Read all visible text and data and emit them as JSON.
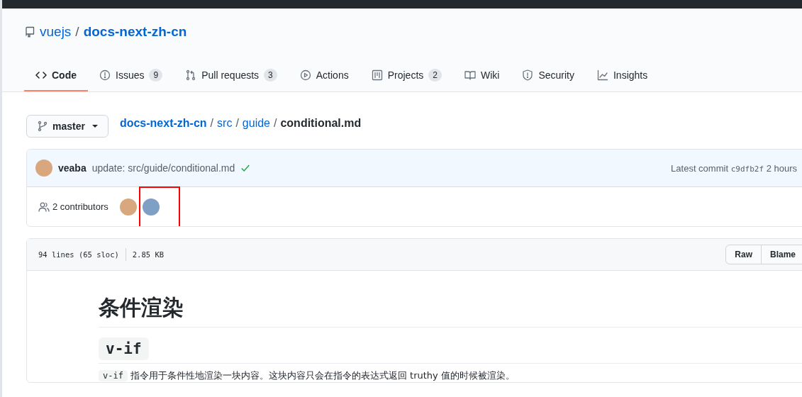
{
  "repo": {
    "owner": "vuejs",
    "separator": "/",
    "name": "docs-next-zh-cn"
  },
  "tabs": [
    {
      "label": "Code",
      "selected": true
    },
    {
      "label": "Issues",
      "count": "9",
      "selected": false
    },
    {
      "label": "Pull requests",
      "count": "3",
      "selected": false
    },
    {
      "label": "Actions",
      "selected": false
    },
    {
      "label": "Projects",
      "count": "2",
      "selected": false
    },
    {
      "label": "Wiki",
      "selected": false
    },
    {
      "label": "Security",
      "selected": false
    },
    {
      "label": "Insights",
      "selected": false
    }
  ],
  "branch": {
    "label": "master"
  },
  "breadcrumb": {
    "links": [
      "docs-next-zh-cn",
      "src",
      "guide"
    ],
    "separator": "/",
    "current": "conditional.md"
  },
  "commit": {
    "author": "veaba",
    "message": "update: src/guide/conditional.md",
    "status_ok": true,
    "latest_label": "Latest commit",
    "sha": "c9dfb2f",
    "time": "2 hours"
  },
  "contributors": {
    "label": "2 contributors",
    "avatars": [
      {
        "highlighted": false
      },
      {
        "highlighted": true
      }
    ]
  },
  "file": {
    "lines": "94 lines (65 sloc)",
    "size": "2.85 KB",
    "buttons": [
      "Raw",
      "Blame"
    ]
  },
  "content": {
    "h1": "条件渲染",
    "h2": "v-if",
    "paragraph_code": "v-if",
    "paragraph": "指令用于条件性地渲染一块内容。这块内容只会在指令的表达式返回 truthy 值的时候被渲染。"
  }
}
